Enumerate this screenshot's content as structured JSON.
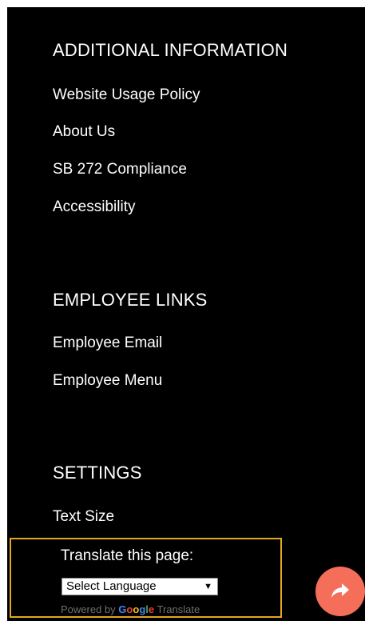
{
  "sections": {
    "additional": {
      "title": "ADDITIONAL INFORMATION",
      "links": [
        "Website Usage Policy",
        "About Us",
        "SB 272 Compliance",
        "Accessibility"
      ]
    },
    "employee": {
      "title": "EMPLOYEE LINKS",
      "links": [
        "Employee Email",
        "Employee Menu"
      ]
    },
    "settings": {
      "title": "SETTINGS",
      "links": [
        "Text Size"
      ]
    }
  },
  "translate": {
    "label": "Translate this page:",
    "select_value": "Select Language",
    "powered_by": "Powered by",
    "google": [
      "G",
      "o",
      "o",
      "g",
      "l",
      "e"
    ],
    "translate_word": "Translate"
  },
  "colors": {
    "panel": "#000000",
    "text": "#ffffff",
    "translate_border": "#e5a623",
    "share_button": "#f46e5a"
  },
  "icons": {
    "share": "share-arrow-icon"
  }
}
